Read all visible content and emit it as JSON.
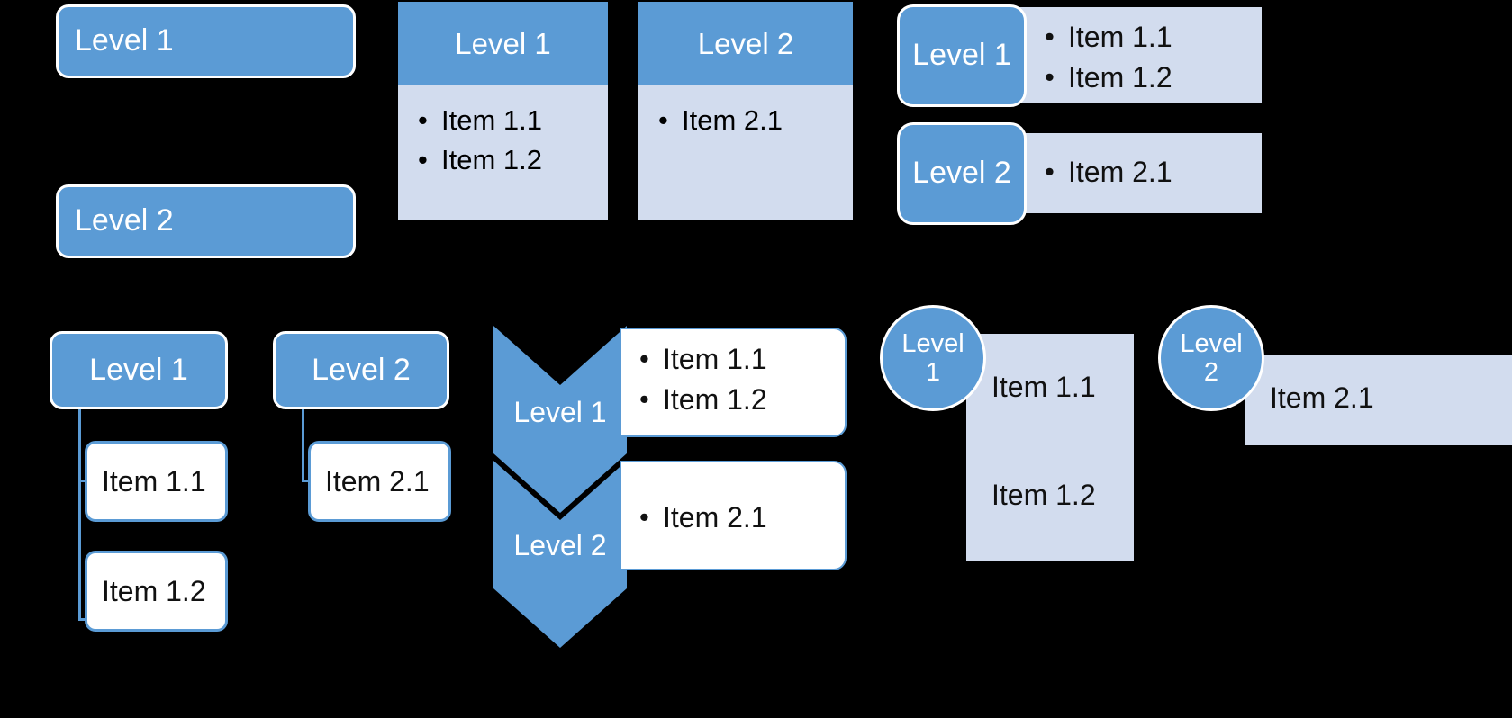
{
  "palette": {
    "background": "#000000",
    "accent_blue": "#5B9BD5",
    "light_blue": "#D2DCEE",
    "white": "#FFFFFF",
    "text_dark": "#111111"
  },
  "labels": {
    "level1": "Level 1",
    "level2": "Level 2",
    "item_1_1": "Item 1.1",
    "item_1_2": "Item 1.2",
    "item_2_1": "Item 2.1",
    "bullet": "•"
  },
  "variants": [
    {
      "id": "plain-rounded-bars",
      "shapes": [
        {
          "name": "level1-bar",
          "label": "Level 1"
        },
        {
          "name": "level2-bar",
          "label": "Level 2"
        }
      ]
    },
    {
      "id": "header-card-columns",
      "cards": [
        {
          "header": "Level 1",
          "items": [
            "Item 1.1",
            "Item 1.2"
          ]
        },
        {
          "header": "Level 2",
          "items": [
            "Item 2.1"
          ]
        }
      ]
    },
    {
      "id": "chip-plus-strip",
      "rows": [
        {
          "chip": "Level 1",
          "items": [
            "Item 1.1",
            "Item 1.2"
          ]
        },
        {
          "chip": "Level 2",
          "items": [
            "Item 2.1"
          ]
        }
      ]
    },
    {
      "id": "tree-connectors",
      "branches": [
        {
          "parent": "Level 1",
          "children": [
            "Item 1.1",
            "Item 1.2"
          ]
        },
        {
          "parent": "Level 2",
          "children": [
            "Item 2.1"
          ]
        }
      ]
    },
    {
      "id": "chevron-process",
      "rows": [
        {
          "chevron": "Level 1",
          "items": [
            "Item 1.1",
            "Item 1.2"
          ]
        },
        {
          "chevron": "Level 2",
          "items": [
            "Item 2.1"
          ]
        }
      ]
    },
    {
      "id": "circle-badge-panels",
      "groups": [
        {
          "circle_line1": "Level",
          "circle_line2": "1",
          "items": [
            "Item 1.1",
            "Item 1.2"
          ]
        },
        {
          "circle_line1": "Level",
          "circle_line2": "2",
          "items": [
            "Item 2.1"
          ]
        }
      ]
    }
  ]
}
